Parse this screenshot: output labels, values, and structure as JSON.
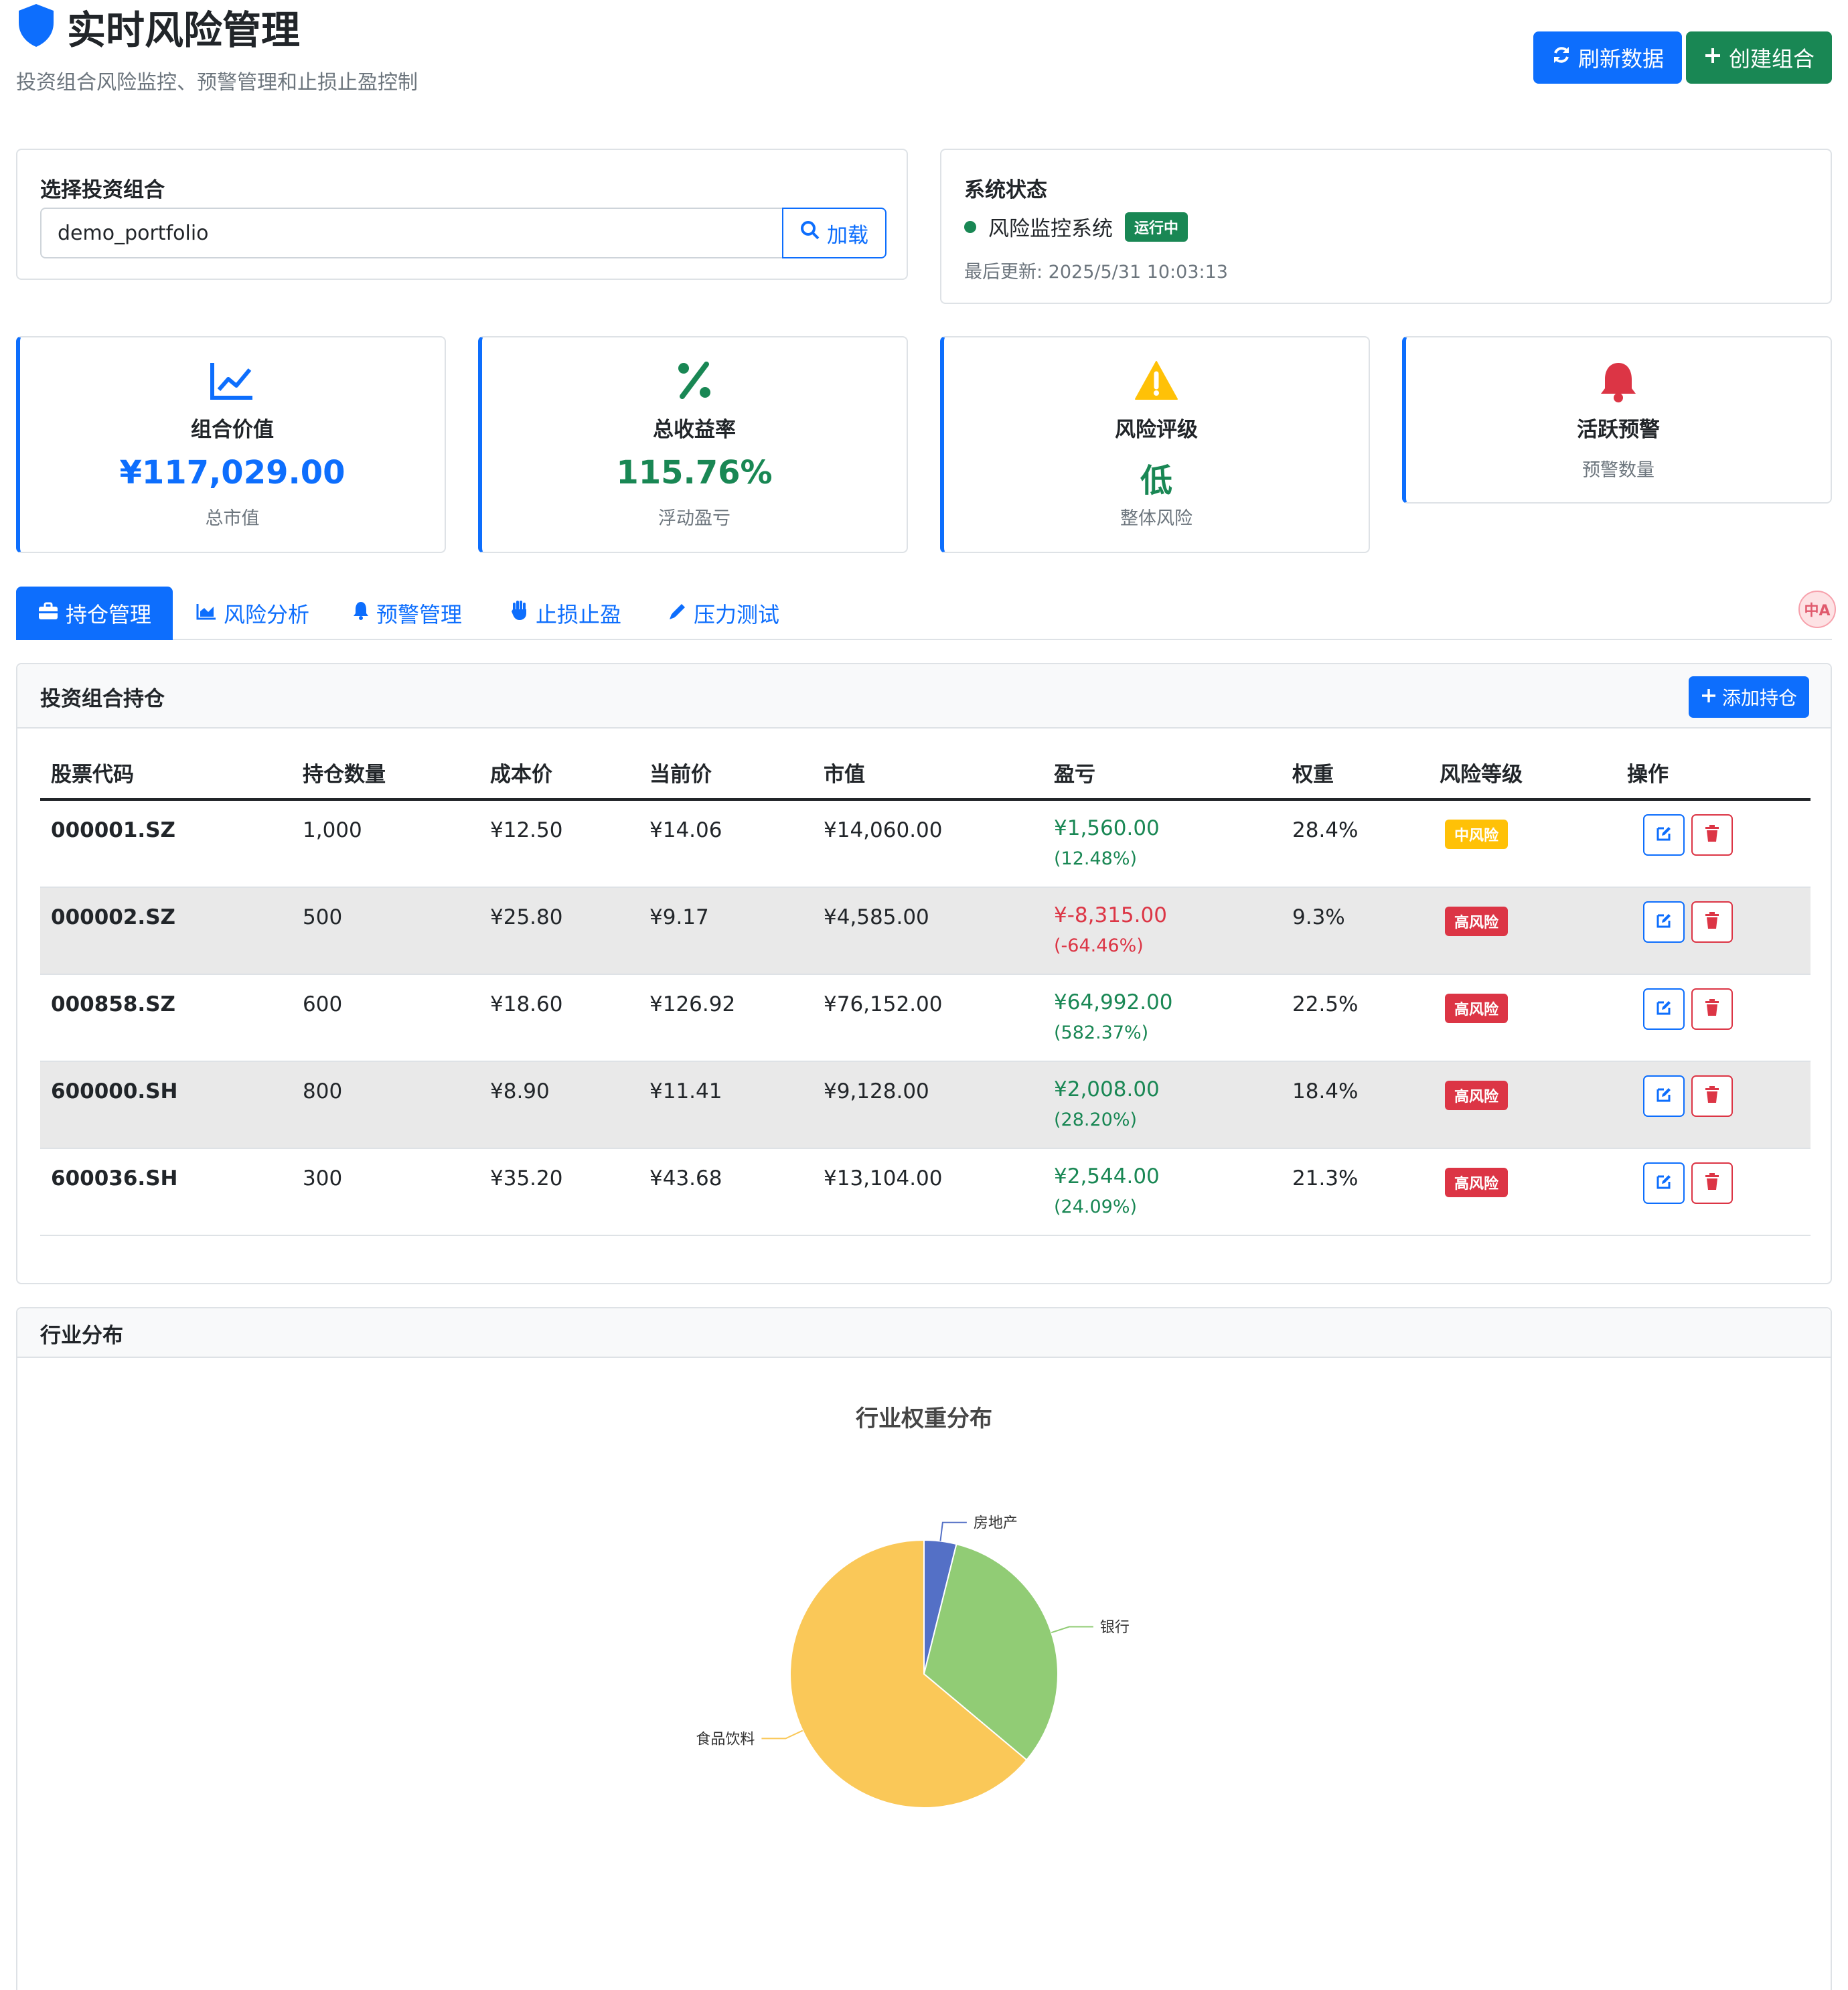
{
  "header": {
    "title": "实时风险管理",
    "subtitle": "投资组合风险监控、预警管理和止损止盈控制",
    "refresh_label": "刷新数据",
    "create_label": "创建组合"
  },
  "portfolio_selector": {
    "label": "选择投资组合",
    "value": "demo_portfolio",
    "load_label": "加载"
  },
  "system_status": {
    "label": "系统状态",
    "system_name": "风险监控系统",
    "badge": "运行中",
    "last_updated": "最后更新: 2025/5/31 10:03:13"
  },
  "metrics": {
    "value": {
      "label": "组合价值",
      "value": "¥117,029.00",
      "sub": "总市值"
    },
    "return": {
      "label": "总收益率",
      "value": "115.76%",
      "sub": "浮动盈亏"
    },
    "risk": {
      "label": "风险评级",
      "value": "低",
      "sub": "整体风险"
    },
    "alerts": {
      "label": "活跃预警",
      "sub": "预警数量"
    }
  },
  "tabs": {
    "positions": "持仓管理",
    "risk_analysis": "风险分析",
    "alerts": "预警管理",
    "stop": "止损止盈",
    "stress": "压力测试"
  },
  "translate_widget": "中A",
  "holdings": {
    "title": "投资组合持仓",
    "add_label": "添加持仓",
    "columns": [
      "股票代码",
      "持仓数量",
      "成本价",
      "当前价",
      "市值",
      "盈亏",
      "权重",
      "风险等级",
      "操作"
    ],
    "rows": [
      {
        "code": "000001.SZ",
        "qty": "1,000",
        "cost": "¥12.50",
        "price": "¥14.06",
        "mv": "¥14,060.00",
        "pnl": "¥1,560.00",
        "pnl_pct": "(12.48%)",
        "pnl_sign": "pos",
        "weight": "28.4%",
        "risk": "中风险",
        "risk_level": "mid"
      },
      {
        "code": "000002.SZ",
        "qty": "500",
        "cost": "¥25.80",
        "price": "¥9.17",
        "mv": "¥4,585.00",
        "pnl": "¥-8,315.00",
        "pnl_pct": "(-64.46%)",
        "pnl_sign": "neg",
        "weight": "9.3%",
        "risk": "高风险",
        "risk_level": "high"
      },
      {
        "code": "000858.SZ",
        "qty": "600",
        "cost": "¥18.60",
        "price": "¥126.92",
        "mv": "¥76,152.00",
        "pnl": "¥64,992.00",
        "pnl_pct": "(582.37%)",
        "pnl_sign": "pos",
        "weight": "22.5%",
        "risk": "高风险",
        "risk_level": "high"
      },
      {
        "code": "600000.SH",
        "qty": "800",
        "cost": "¥8.90",
        "price": "¥11.41",
        "mv": "¥9,128.00",
        "pnl": "¥2,008.00",
        "pnl_pct": "(28.20%)",
        "pnl_sign": "pos",
        "weight": "18.4%",
        "risk": "高风险",
        "risk_level": "high"
      },
      {
        "code": "600036.SH",
        "qty": "300",
        "cost": "¥35.20",
        "price": "¥43.68",
        "mv": "¥13,104.00",
        "pnl": "¥2,544.00",
        "pnl_pct": "(24.09%)",
        "pnl_sign": "pos",
        "weight": "21.3%",
        "risk": "高风险",
        "risk_level": "high"
      }
    ]
  },
  "industry": {
    "title": "行业分布"
  },
  "colors": {
    "primary": "#0d6efd",
    "success": "#198754",
    "danger": "#dc3545",
    "warning": "#ffc107"
  },
  "chart_data": {
    "type": "pie",
    "title": "行业权重分布",
    "categories": [
      "房地产",
      "银行",
      "食品饮料"
    ],
    "values": [
      3.9,
      32.2,
      63.9
    ],
    "colors": [
      "#5470c6",
      "#91cc75",
      "#fac858"
    ]
  }
}
